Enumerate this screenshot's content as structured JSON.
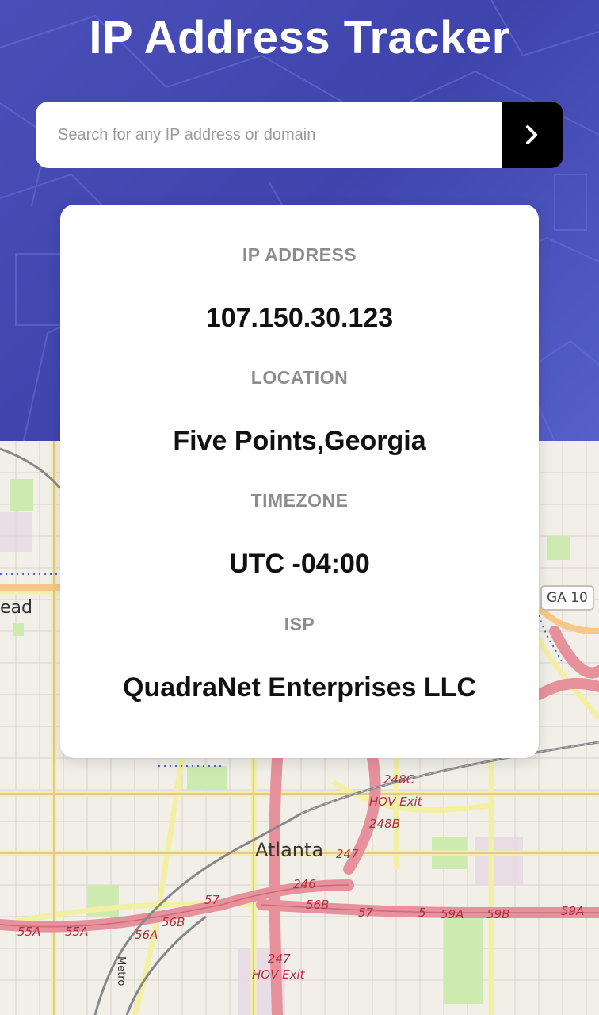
{
  "header": {
    "title": "IP Address Tracker"
  },
  "search": {
    "placeholder": "Search for any IP address or domain",
    "value": "",
    "button_icon": "chevron-right-icon"
  },
  "info": {
    "ip_label": "IP ADDRESS",
    "ip_value": "107.150.30.123",
    "location_label": "LOCATION",
    "location_value": "Five Points,Georgia",
    "timezone_label": "TIMEZONE",
    "timezone_value": "UTC -04:00",
    "isp_label": "ISP",
    "isp_value": "QuadraNet Enterprises LLC"
  },
  "map": {
    "city_label": "Atlanta",
    "partial_label": "ead",
    "shield_label": "GA 10",
    "vertical_label": "Metro",
    "exit_labels": [
      "248C",
      "HOV Exit",
      "248B",
      "247",
      "246",
      "56B",
      "57",
      "57",
      "5",
      "59A",
      "59B",
      "59A",
      "55A",
      "55A",
      "56A",
      "56B",
      "247",
      "HOV Exit"
    ]
  },
  "colors": {
    "header_bg": "#4a4fb8",
    "search_button_bg": "#000000",
    "card_bg": "#ffffff",
    "label_gray": "#8c8c8c",
    "map_bg": "#f2efe9",
    "highway": "#e8929f",
    "road_yellow": "#f7fabf"
  }
}
